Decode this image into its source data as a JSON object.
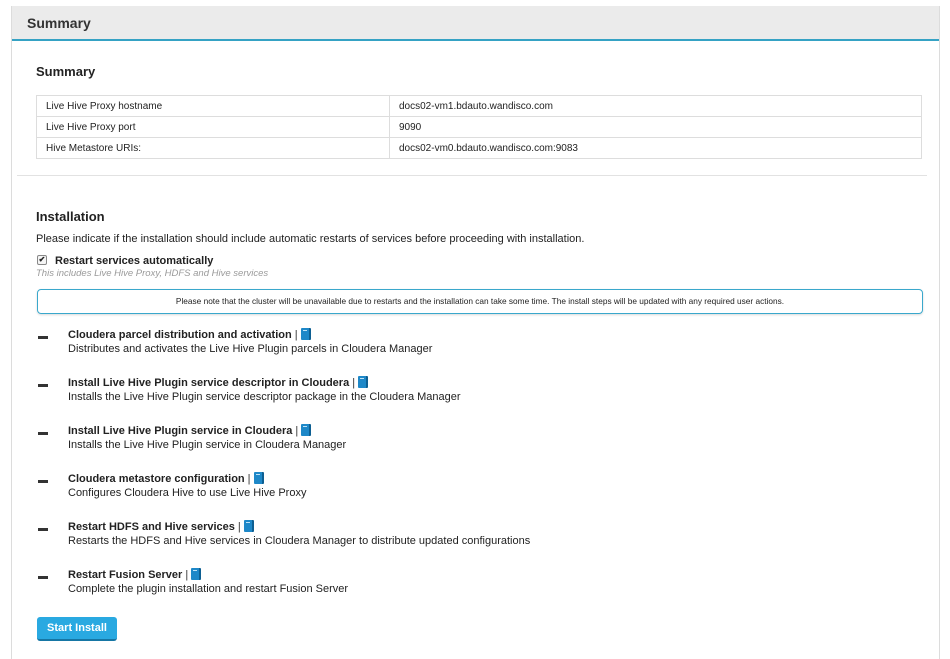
{
  "panel": {
    "header_title": "Summary"
  },
  "summary": {
    "title": "Summary",
    "rows": [
      {
        "key": "Live Hive Proxy hostname",
        "value": "docs02-vm1.bdauto.wandisco.com"
      },
      {
        "key": "Live Hive Proxy port",
        "value": "9090"
      },
      {
        "key": "Hive Metastore URIs:",
        "value": "docs02-vm0.bdauto.wandisco.com:9083"
      }
    ]
  },
  "installation": {
    "title": "Installation",
    "intro": "Please indicate if the installation should include automatic restarts of services before proceeding with installation.",
    "restart_checkbox": {
      "label": "Restart services automatically",
      "checked": true,
      "check_glyph": "✔"
    },
    "restart_hint": "This includes Live Hive Proxy, HDFS and Hive services",
    "notice": "Please note that the cluster will be unavailable due to restarts and the installation can take some time. The install steps will be updated with any required user actions.",
    "separator": "|",
    "steps": [
      {
        "title": "Cloudera parcel distribution and activation",
        "description": "Distributes and activates the Live Hive Plugin parcels in Cloudera Manager",
        "icon": "book-icon"
      },
      {
        "title": "Install Live Hive Plugin service descriptor in Cloudera",
        "description": "Installs the Live Hive Plugin service descriptor package in the Cloudera Manager",
        "icon": "book-icon"
      },
      {
        "title": "Install Live Hive Plugin service in Cloudera",
        "description": "Installs the Live Hive Plugin service in Cloudera Manager",
        "icon": "book-icon"
      },
      {
        "title": "Cloudera metastore configuration",
        "description": "Configures Cloudera Hive to use Live Hive Proxy",
        "icon": "book-icon"
      },
      {
        "title": "Restart HDFS and Hive services",
        "description": "Restarts the HDFS and Hive services in Cloudera Manager to distribute updated configurations",
        "icon": "book-icon"
      },
      {
        "title": "Restart Fusion Server",
        "description": "Complete the plugin installation and restart Fusion Server",
        "icon": "book-icon"
      }
    ],
    "start_button": "Start Install"
  },
  "colors": {
    "accent": "#35a2c4",
    "button": "#29a9e1",
    "header_bg": "#ebebeb"
  }
}
